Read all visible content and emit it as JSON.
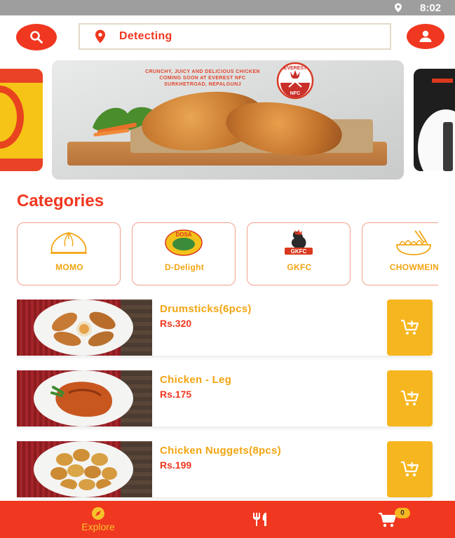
{
  "status_bar": {
    "time": "8:02",
    "location_icon": "location-pin-icon"
  },
  "header": {
    "search_icon": "search-icon",
    "location_text": "Detecting",
    "profile_icon": "person-icon"
  },
  "banner": {
    "tagline_line1": "Crunchy, juicy and delicious chicken",
    "tagline_line2": "Coming soon at Everest NFC",
    "tagline_line3": "Surkhetroad, Nepalgunj",
    "logo_top": "EVEREST",
    "logo_bottom": "NFC"
  },
  "categories": {
    "title": "Categories",
    "items": [
      {
        "label": "MOMO",
        "icon": "momo-icon"
      },
      {
        "label": "D-Delight",
        "icon": "dosa-delight-logo",
        "logo_text": "DOSA"
      },
      {
        "label": "GKFC",
        "icon": "gkfc-rooster-logo",
        "logo_text": "GKFC"
      },
      {
        "label": "CHOWMEIN",
        "icon": "noodles-icon"
      }
    ]
  },
  "products": [
    {
      "name": "Drumsticks(6pcs)",
      "price": "Rs.320"
    },
    {
      "name": "Chicken - Leg",
      "price": "Rs.175"
    },
    {
      "name": "Chicken Nuggets(8pcs)",
      "price": "Rs.199"
    }
  ],
  "bottom_nav": {
    "explore_label": "Explore",
    "cart_count": "0"
  },
  "colors": {
    "brand_red": "#f0371f",
    "accent_yellow": "#f6b61f",
    "name_orange": "#f2a512"
  }
}
